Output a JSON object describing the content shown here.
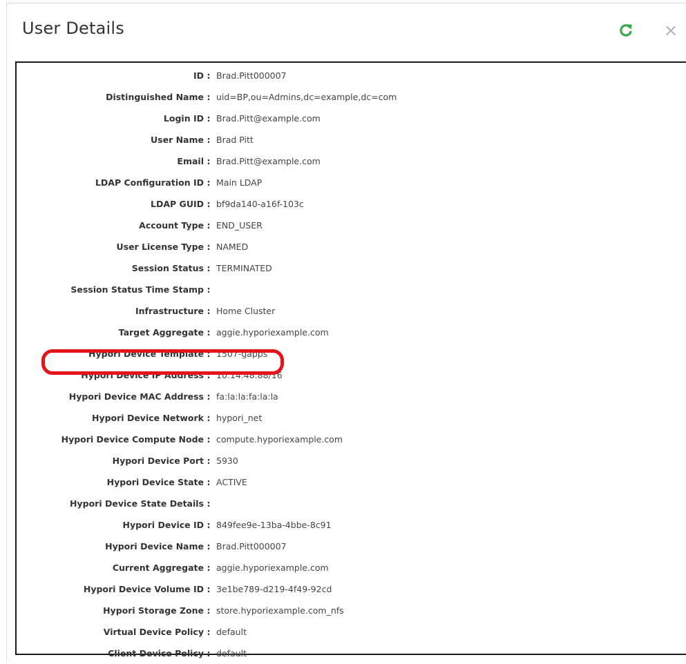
{
  "dialog": {
    "title": "User Details",
    "refresh_icon": "refresh-icon",
    "close_icon": "close-icon",
    "close_glyph": "×",
    "accent_color": "#3aa64c",
    "highlight_color": "#e3151a"
  },
  "details": [
    {
      "label": "ID",
      "value": "Brad.Pitt000007"
    },
    {
      "label": "Distinguished Name",
      "value": "uid=BP,ou=Admins,dc=example,dc=com"
    },
    {
      "label": "Login ID",
      "value": "Brad.Pitt@example.com"
    },
    {
      "label": "User Name",
      "value": "Brad Pitt"
    },
    {
      "label": "Email",
      "value": "Brad.Pitt@example.com"
    },
    {
      "label": "LDAP Configuration ID",
      "value": "Main LDAP"
    },
    {
      "label": "LDAP GUID",
      "value": "bf9da140-a16f-103c"
    },
    {
      "label": "Account Type",
      "value": "END_USER"
    },
    {
      "label": "User License Type",
      "value": "NAMED"
    },
    {
      "label": "Session Status",
      "value": "TERMINATED"
    },
    {
      "label": "Session Status Time Stamp",
      "value": ""
    },
    {
      "label": "Infrastructure",
      "value": "Home Cluster"
    },
    {
      "label": "Target Aggregate",
      "value": "aggie.hyporiexample.com"
    },
    {
      "label": "Hypori Device Template",
      "value": "1507-gapps"
    },
    {
      "label": "Hypori Device IP Address",
      "value": "10.14.48.88/16"
    },
    {
      "label": "Hypori Device MAC Address",
      "value": "fa:la:la:fa:la:la"
    },
    {
      "label": "Hypori Device Network",
      "value": "hypori_net"
    },
    {
      "label": "Hypori Device Compute Node",
      "value": "compute.hyporiexample.com"
    },
    {
      "label": "Hypori Device Port",
      "value": "5930"
    },
    {
      "label": "Hypori Device State",
      "value": "ACTIVE"
    },
    {
      "label": "Hypori Device State Details",
      "value": ""
    },
    {
      "label": "Hypori Device ID",
      "value": "849fee9e-13ba-4bbe-8c91"
    },
    {
      "label": "Hypori Device Name",
      "value": "Brad.Pitt000007"
    },
    {
      "label": "Current Aggregate",
      "value": "aggie.hyporiexample.com"
    },
    {
      "label": "Hypori Device Volume ID",
      "value": "3e1be789-d219-4f49-92cd"
    },
    {
      "label": "Hypori Storage Zone",
      "value": "store.hyporiexample.com_nfs"
    },
    {
      "label": "Virtual Device Policy",
      "value": "default"
    },
    {
      "label": "Client Device Policy",
      "value": "default"
    }
  ]
}
